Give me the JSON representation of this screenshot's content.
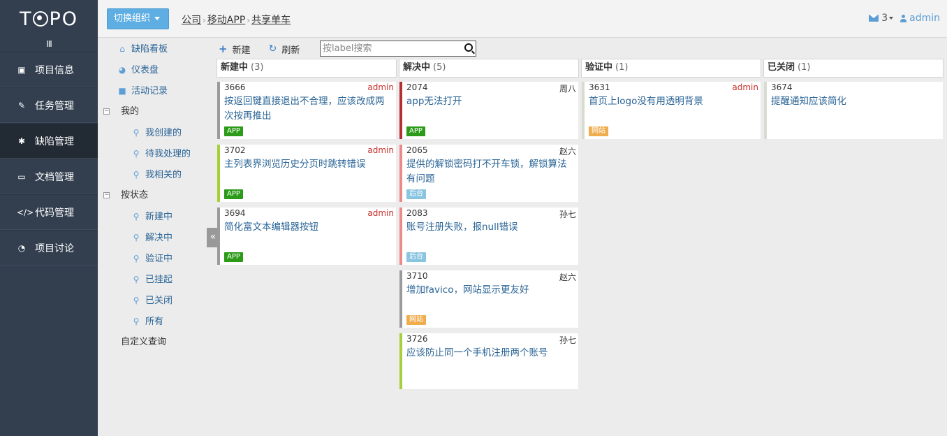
{
  "app": {
    "logo": "TOPO",
    "collapse_icon": "III"
  },
  "sidebar": {
    "items": [
      {
        "label": "项目信息",
        "icon": "doc-icon"
      },
      {
        "label": "任务管理",
        "icon": "tasks-icon"
      },
      {
        "label": "缺陷管理",
        "icon": "bug-icon",
        "active": true
      },
      {
        "label": "文档管理",
        "icon": "folder-icon"
      },
      {
        "label": "代码管理",
        "icon": "code-icon"
      },
      {
        "label": "项目讨论",
        "icon": "chat-icon"
      }
    ]
  },
  "header": {
    "org_button": "切换组织",
    "breadcrumb": [
      "公司",
      "移动APP",
      "共享单车"
    ],
    "mail_count": "3",
    "user": "admin"
  },
  "tree": {
    "board": "缺陷看板",
    "dashboard": "仪表盘",
    "activity": "活动记录",
    "mine": "我的",
    "mine_items": [
      "我创建的",
      "待我处理的",
      "我相关的"
    ],
    "by_status": "按状态",
    "status_items": [
      "新建中",
      "解决中",
      "验证中",
      "已挂起",
      "已关闭",
      "所有"
    ],
    "custom_query": "自定义查询"
  },
  "toolbar": {
    "new_label": "新建",
    "refresh_label": "刷新",
    "search_placeholder": "按label搜索"
  },
  "colors": {
    "red": "#b52f2f",
    "gray": "#9a9a9a",
    "lime": "#a6cf3b",
    "pink": "#ec8a8a",
    "light": "#d8dbcf",
    "tag_app": "#2c9b19",
    "tag_backend": "#89c4e0",
    "tag_web": "#f0ad4e"
  },
  "columns": [
    {
      "name": "新建中",
      "count": "(3)",
      "cards": [
        {
          "id": "3666",
          "assignee": "admin",
          "title": "按返回键直接退出不合理，应该改成两次按再推出",
          "tag": "APP"
        },
        {
          "id": "3702",
          "assignee": "admin",
          "title": "主列表界浏览历史分页时跳转错误",
          "tag": "APP"
        },
        {
          "id": "3694",
          "assignee": "admin",
          "title": "简化富文本编辑器按钮",
          "tag": "APP"
        }
      ]
    },
    {
      "name": "解决中",
      "count": "(5)",
      "cards": [
        {
          "id": "2074",
          "assignee": "周八",
          "title": "app无法打开",
          "tag": "APP"
        },
        {
          "id": "2065",
          "assignee": "赵六",
          "title": "提供的解锁密码打不开车锁，解锁算法有问题",
          "tag": "后台"
        },
        {
          "id": "2083",
          "assignee": "孙七",
          "title": "账号注册失败，报null错误",
          "tag": "后台"
        },
        {
          "id": "3710",
          "assignee": "赵六",
          "title": "增加favico，网站显示更友好",
          "tag": "网站"
        },
        {
          "id": "3726",
          "assignee": "孙七",
          "title": "应该防止同一个手机注册两个账号",
          "tag": ""
        }
      ]
    },
    {
      "name": "验证中",
      "count": "(1)",
      "cards": [
        {
          "id": "3631",
          "assignee": "admin",
          "title": "首页上logo没有用透明背景",
          "tag": "网站"
        }
      ]
    },
    {
      "name": "已关闭",
      "count": "(1)",
      "cards": [
        {
          "id": "3674",
          "assignee": "",
          "title": "提醒通知应该简化",
          "tag": ""
        }
      ]
    }
  ]
}
